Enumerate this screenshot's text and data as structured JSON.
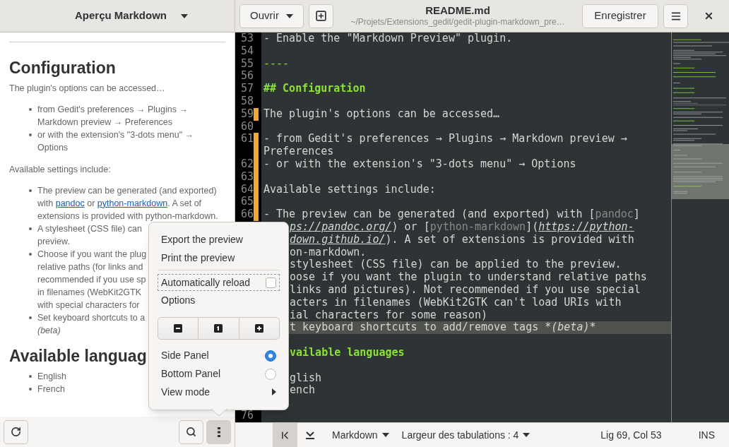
{
  "preview_panel": {
    "title": "Aperçu Markdown",
    "content": [
      {
        "kind": "rule"
      },
      {
        "kind": "heading",
        "text": "Configuration"
      },
      {
        "kind": "paragraph",
        "text": "The plugin's options can be accessed…"
      },
      {
        "kind": "list",
        "items": [
          {
            "lines": [
              "from Gedit's preferences → Plugins →",
              "Markdown preview → Preferences"
            ]
          },
          {
            "lines": [
              "or with the extension's \"3-dots menu\" →",
              "Options"
            ]
          }
        ]
      },
      {
        "kind": "paragraph",
        "text": "Available settings include:"
      },
      {
        "kind": "list",
        "items": [
          {
            "lines": [
              "The preview can be generated (and exported)",
              [
                {
                  "kind": "text",
                  "text": "with "
                },
                {
                  "kind": "link",
                  "text": "pandoc"
                },
                {
                  "kind": "text",
                  "text": " or "
                },
                {
                  "kind": "link",
                  "text": "python-markdown"
                },
                {
                  "kind": "text",
                  "text": ". A set of"
                }
              ],
              "extensions is provided with python-markdown."
            ]
          },
          {
            "lines": [
              "A stylesheet (CSS file) can",
              "preview."
            ]
          },
          {
            "lines": [
              "Choose if you want the plug",
              "relative paths (for links and",
              "recommended if you use sp",
              "in filenames (WebKit2GTK",
              "with special characters for"
            ]
          },
          {
            "lines": [
              "Set keyboard shortcuts to a",
              [
                {
                  "kind": "italic",
                  "text": "(beta)"
                }
              ]
            ]
          }
        ]
      },
      {
        "kind": "heading",
        "text": "Available languag"
      },
      {
        "kind": "list",
        "items": [
          {
            "lines": [
              "English"
            ]
          },
          {
            "lines": [
              "French"
            ]
          }
        ]
      }
    ],
    "bottom_buttons": [
      {
        "kind": "refresh",
        "pressed": false
      },
      {
        "kind": "search",
        "pressed": false
      },
      {
        "kind": "more",
        "pressed": true
      }
    ]
  },
  "header": {
    "open_button": "Ouvrir",
    "title": "README.md",
    "subtitle": "~/Projets/Extensions_gedit/gedit-plugin-markdown_pre…",
    "save_button": "Enregistrer"
  },
  "editor": {
    "lines": [
      {
        "number": "53",
        "changed": false,
        "segments": [
          {
            "kind": "plain",
            "text": "- Enable the \"Markdown Preview\" plugin."
          }
        ]
      },
      {
        "number": "54",
        "changed": false
      },
      {
        "number": "55",
        "changed": false,
        "segments": [
          {
            "kind": "rule",
            "text": "----"
          }
        ]
      },
      {
        "number": "56",
        "changed": false
      },
      {
        "number": "57",
        "changed": false,
        "segments": [
          {
            "kind": "heading",
            "text": "## Configuration"
          }
        ]
      },
      {
        "number": "58",
        "changed": false
      },
      {
        "number": "59",
        "changed": true,
        "segments": [
          {
            "kind": "plain",
            "text": "The plugin's options can be accessed…"
          }
        ]
      },
      {
        "number": "60",
        "changed": false
      },
      {
        "number": "61",
        "changed": true,
        "segments": [
          {
            "kind": "plain",
            "text": "- from Gedit's preferences → Plugins → Markdown preview →"
          }
        ]
      },
      {
        "changed": true,
        "segments": [
          {
            "kind": "plain",
            "text": "Preferences"
          }
        ]
      },
      {
        "number": "62",
        "changed": true,
        "segments": [
          {
            "kind": "plain",
            "text": "- or with the extension's \"3-dots menu\" → Options"
          }
        ]
      },
      {
        "number": "63",
        "changed": true
      },
      {
        "number": "64",
        "changed": true,
        "segments": [
          {
            "kind": "plain",
            "text": "Available settings include:"
          }
        ]
      },
      {
        "number": "65",
        "changed": true
      },
      {
        "number": "66",
        "changed": true,
        "segments": [
          {
            "kind": "plain",
            "text": "- The preview can be generated (and exported) with ["
          },
          {
            "kind": "dim",
            "text": "pandoc"
          },
          {
            "kind": "plain",
            "text": "]"
          }
        ]
      },
      {
        "covered": true,
        "segments": [
          {
            "kind": "url",
            "text": "ps://pandoc.org/"
          },
          {
            "kind": "plain",
            "text": ") or ["
          },
          {
            "kind": "dim",
            "text": "python-markdown"
          },
          {
            "kind": "plain",
            "text": "]("
          },
          {
            "kind": "url",
            "text": "https://python-"
          }
        ]
      },
      {
        "covered": true,
        "segments": [
          {
            "kind": "url",
            "text": "down.github.io/"
          },
          {
            "kind": "plain",
            "text": "). A set of extensions is provided with"
          }
        ]
      },
      {
        "covered": true,
        "segments": [
          {
            "kind": "plain",
            "text": "on-markdown."
          }
        ]
      },
      {
        "covered": true,
        "segments": [
          {
            "kind": "plain",
            "text": "stylesheet (CSS file) can be applied to the preview."
          }
        ]
      },
      {
        "covered": true,
        "segments": [
          {
            "kind": "plain",
            "text": "oose if you want the plugin to understand relative paths"
          }
        ]
      },
      {
        "covered": true,
        "segments": [
          {
            "kind": "plain",
            "text": "links and pictures). Not recommended if you use special"
          }
        ]
      },
      {
        "covered": true,
        "segments": [
          {
            "kind": "plain",
            "text": "acters in filenames (WebKit2GTK can't load URIs with"
          }
        ]
      },
      {
        "covered": true,
        "segments": [
          {
            "kind": "plain",
            "text": "ial characters for some reason)"
          }
        ]
      },
      {
        "covered": true,
        "current": true,
        "segments": [
          {
            "kind": "plain",
            "text": "t keyboard shortcuts to add/remove tags *"
          },
          {
            "kind": "italic",
            "text": "(beta)"
          },
          {
            "kind": "plain",
            "text": "*"
          }
        ]
      },
      {
        "covered": true,
        "blank_line_before": true,
        "segments": [
          {
            "kind": "heading",
            "text": "vailable languages"
          }
        ]
      },
      {
        "covered": true,
        "blank_line_before": true,
        "segments": [
          {
            "kind": "plain",
            "text": "glish"
          }
        ]
      },
      {
        "covered": true,
        "segments": [
          {
            "kind": "plain",
            "text": "ench"
          }
        ]
      },
      {
        "number": "76",
        "changed": false,
        "blank_line_before": true
      }
    ]
  },
  "menu": {
    "items": [
      {
        "kind": "action",
        "label": "Export the preview"
      },
      {
        "kind": "action",
        "label": "Print the preview"
      },
      {
        "kind": "separator"
      },
      {
        "kind": "check",
        "label": "Automatically reload",
        "checked": false,
        "focused": true
      },
      {
        "kind": "action",
        "label": "Options"
      },
      {
        "kind": "zoom",
        "buttons": [
          {
            "kind": "minus"
          },
          {
            "kind": "reset"
          },
          {
            "kind": "plus"
          }
        ]
      },
      {
        "kind": "radio",
        "label": "Side Panel",
        "selected": true
      },
      {
        "kind": "radio",
        "label": "Bottom Panel",
        "selected": false
      },
      {
        "kind": "submenu",
        "label": "View mode"
      }
    ]
  },
  "status_bar": {
    "buttons": [
      {
        "kind": "first",
        "selected": true
      },
      {
        "kind": "bottom",
        "selected": false
      }
    ],
    "language": "Markdown",
    "tab_width": "Largeur des tabulations : 4",
    "position": "Lig 69, Col 53",
    "mode": "INS"
  }
}
